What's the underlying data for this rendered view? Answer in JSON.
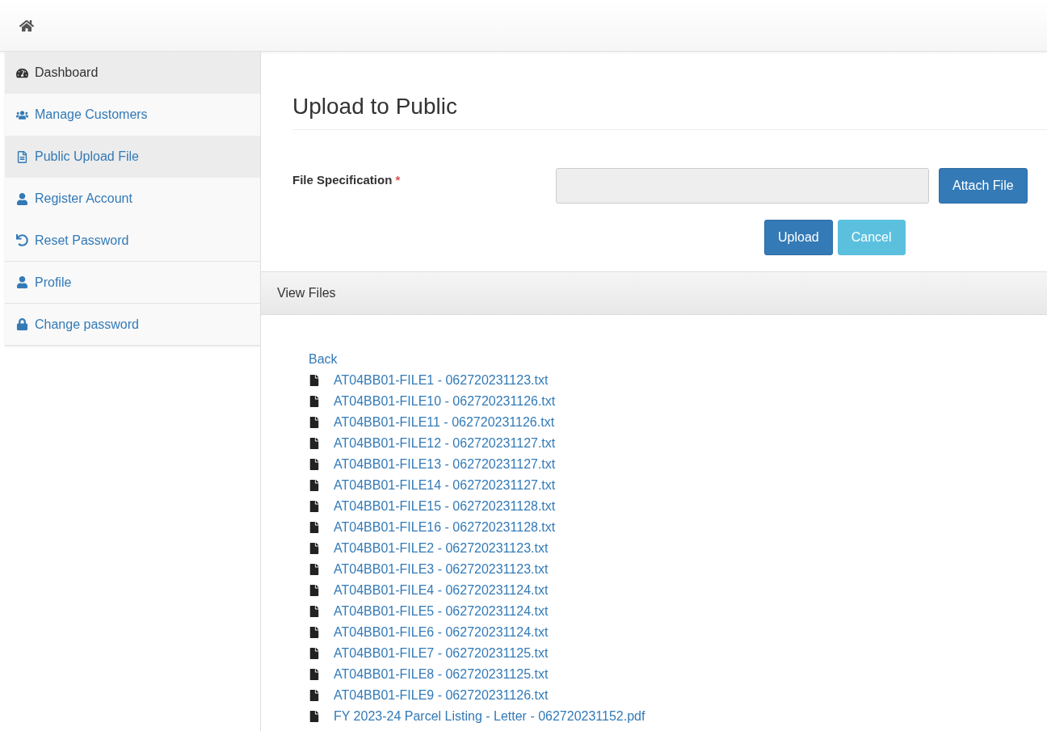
{
  "sidebar": {
    "items": [
      {
        "label": "Dashboard",
        "selected": false,
        "hovered": true
      },
      {
        "label": "Manage Customers",
        "selected": false,
        "hovered": false
      },
      {
        "label": "Public Upload File",
        "selected": true,
        "hovered": false
      },
      {
        "label": "Register Account",
        "selected": false,
        "hovered": false
      },
      {
        "label": "Reset Password",
        "selected": false,
        "hovered": false
      },
      {
        "label": "Profile",
        "selected": false,
        "hovered": false
      },
      {
        "label": "Change password",
        "selected": false,
        "hovered": false
      }
    ]
  },
  "page_title": "Upload to Public",
  "form": {
    "label": "File Specification",
    "required_mark": "*",
    "attach_button": "Attach File",
    "upload_button": "Upload",
    "cancel_button": "Cancel"
  },
  "files_panel": {
    "title": "View Files",
    "back_link": "Back",
    "files": [
      "AT04BB01-FILE1 - 062720231123.txt",
      "AT04BB01-FILE10 - 062720231126.txt",
      "AT04BB01-FILE11 - 062720231126.txt",
      "AT04BB01-FILE12 - 062720231127.txt",
      "AT04BB01-FILE13 - 062720231127.txt",
      "AT04BB01-FILE14 - 062720231127.txt",
      "AT04BB01-FILE15 - 062720231128.txt",
      "AT04BB01-FILE16 - 062720231128.txt",
      "AT04BB01-FILE2 - 062720231123.txt",
      "AT04BB01-FILE3 - 062720231123.txt",
      "AT04BB01-FILE4 - 062720231124.txt",
      "AT04BB01-FILE5 - 062720231124.txt",
      "AT04BB01-FILE6 - 062720231124.txt",
      "AT04BB01-FILE7 - 062720231125.txt",
      "AT04BB01-FILE8 - 062720231125.txt",
      "AT04BB01-FILE9 - 062720231126.txt",
      "FY 2023-24 Parcel Listing - Letter - 062720231152.pdf"
    ]
  }
}
